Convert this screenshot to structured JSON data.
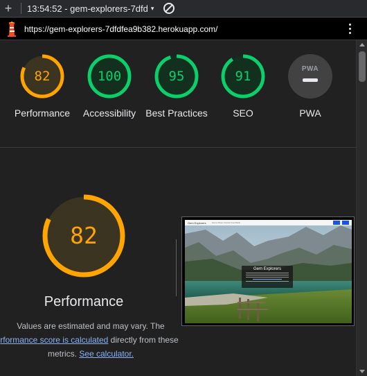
{
  "toolbar": {
    "plus": "+",
    "session": "13:54:52 - gem-explorers-7dfd",
    "caret": "▾"
  },
  "urlbar": {
    "url": "https://gem-explorers-7dfdfea9b382.herokuapp.com/"
  },
  "scores": [
    {
      "label": "Performance",
      "value": "82",
      "color": "#ffa400",
      "fraction": 0.82
    },
    {
      "label": "Accessibility",
      "value": "100",
      "color": "#0cce6b",
      "fraction": 1.0
    },
    {
      "label": "Best Practices",
      "value": "95",
      "color": "#0cce6b",
      "fraction": 0.95
    },
    {
      "label": "SEO",
      "value": "91",
      "color": "#0cce6b",
      "fraction": 0.91
    }
  ],
  "pwa": {
    "label": "PWA",
    "badge_text": "PWA"
  },
  "performance": {
    "value": "82",
    "fraction": 0.82,
    "title": "Performance",
    "note_line1": "Values are estimated and may vary. The",
    "note_link1": "rformance score is calculated",
    "note_after_link1": " directly from these",
    "note_line3_prefix": "metrics. ",
    "note_link2": "See calculator."
  },
  "screenshot": {
    "brand": "Gem Explorers",
    "nav_links": "Home   Maps   Contact   Feedback",
    "hero_title": "Gem Explorers"
  },
  "colors": {
    "average": "#ffa400",
    "pass": "#0cce6b",
    "link": "#8ab4f8"
  }
}
